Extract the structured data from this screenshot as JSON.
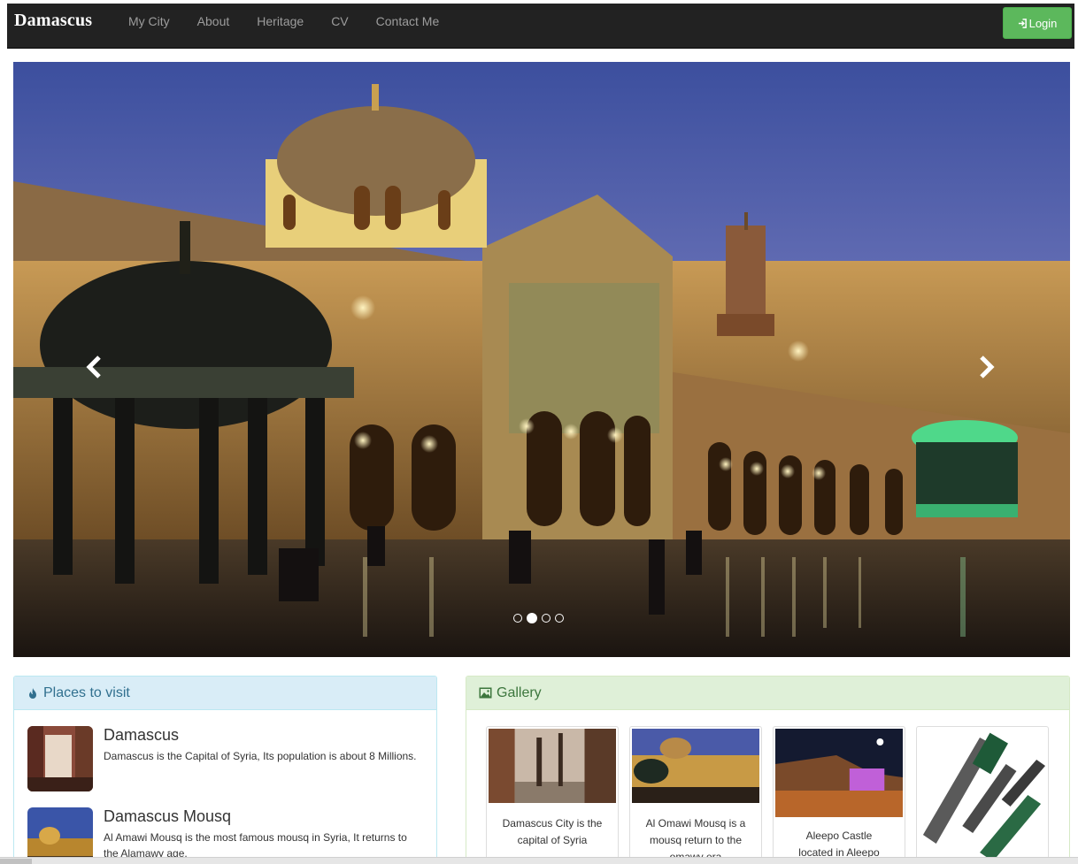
{
  "navbar": {
    "brand": "Damascus",
    "items": [
      "My City",
      "About",
      "Heritage",
      "CV",
      "Contact Me"
    ],
    "login_label": "Login"
  },
  "carousel": {
    "slide_count": 4,
    "active_index": 1
  },
  "places": {
    "heading": "Places to visit",
    "items": [
      {
        "title": "Damascus",
        "text": "Damascus is the Capital of Syria, Its population is about 8 Millions."
      },
      {
        "title": "Damascus Mousq",
        "text": "Al Amawi Mousq is the most famous mousq in Syria, It returns to the Alamawy age."
      }
    ]
  },
  "gallery": {
    "heading": "Gallery",
    "items": [
      {
        "caption": "Damascus City is the capital of Syria"
      },
      {
        "caption": "Al Omawi Mousq is a mousq return to the omawy era"
      },
      {
        "caption": "Aleepo Castle located in Aleepo"
      },
      {
        "caption": ""
      }
    ]
  },
  "colors": {
    "navbar_bg": "#222222",
    "login_green": "#5cb85c",
    "info_panel": "#d9edf7",
    "success_panel": "#dff0d8"
  }
}
